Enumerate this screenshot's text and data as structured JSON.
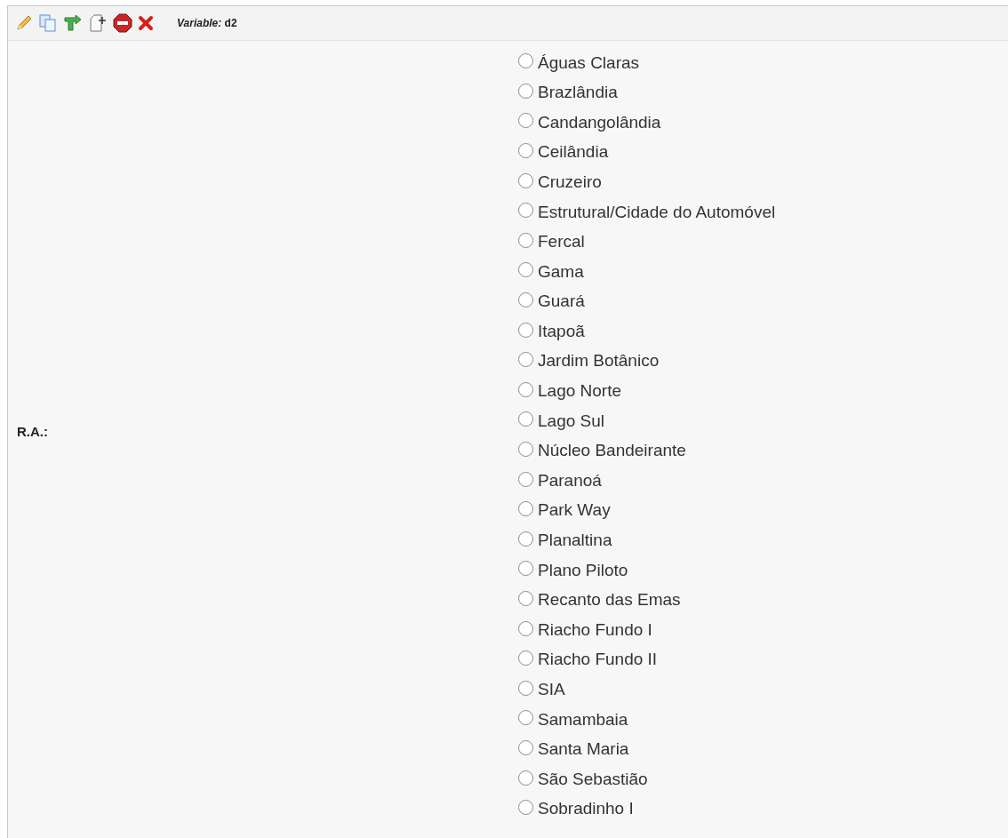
{
  "toolbar": {
    "variable_label": "Variable:",
    "variable_name": "d2"
  },
  "field": {
    "label": "R.A.:",
    "options": [
      {
        "label": "Águas Claras",
        "selected": false
      },
      {
        "label": "Brazlândia",
        "selected": false
      },
      {
        "label": "Candangolândia",
        "selected": false
      },
      {
        "label": "Ceilândia",
        "selected": false
      },
      {
        "label": "Cruzeiro",
        "selected": false
      },
      {
        "label": "Estrutural/Cidade do Automóvel",
        "selected": false
      },
      {
        "label": "Fercal",
        "selected": false
      },
      {
        "label": "Gama",
        "selected": false
      },
      {
        "label": "Guará",
        "selected": false
      },
      {
        "label": "Itapoã",
        "selected": false
      },
      {
        "label": "Jardim Botânico",
        "selected": false
      },
      {
        "label": "Lago Norte",
        "selected": false
      },
      {
        "label": "Lago Sul",
        "selected": false
      },
      {
        "label": "Núcleo Bandeirante",
        "selected": false
      },
      {
        "label": "Paranoá",
        "selected": false
      },
      {
        "label": "Park Way",
        "selected": false
      },
      {
        "label": "Planaltina",
        "selected": false
      },
      {
        "label": "Plano Piloto",
        "selected": false
      },
      {
        "label": "Recanto das Emas",
        "selected": false
      },
      {
        "label": "Riacho Fundo I",
        "selected": false
      },
      {
        "label": "Riacho Fundo II",
        "selected": false
      },
      {
        "label": "SIA",
        "selected": false
      },
      {
        "label": "Samambaia",
        "selected": false
      },
      {
        "label": "Santa Maria",
        "selected": false
      },
      {
        "label": "São Sebastião",
        "selected": false
      },
      {
        "label": "Sobradinho I",
        "selected": false
      }
    ]
  }
}
